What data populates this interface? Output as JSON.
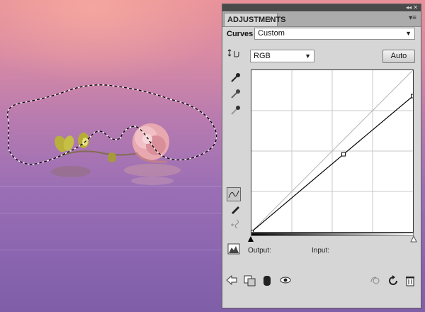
{
  "panel": {
    "tab_title": "ADJUSTMENTS",
    "tab_close": "×",
    "titlebar_buttons": "◂◂ ✕",
    "menu_icon": "▾≡",
    "adjustment_label": "Curves",
    "preset_value": "Custom",
    "channel_value": "RGB",
    "auto_label": "Auto",
    "output_label": "Output:",
    "input_label": "Input:"
  },
  "curve": {
    "points": [
      [
        0,
        0
      ],
      [
        57,
        48
      ],
      [
        100,
        84
      ]
    ]
  },
  "icons": {
    "left_tools": [
      "on-image-adjust-icon",
      "eyedropper-black-icon",
      "eyedropper-gray-icon",
      "eyedropper-white-icon"
    ],
    "mode_tools": [
      "curve-points-icon",
      "pencil-draw-icon",
      "smooth-curve-icon"
    ],
    "bottom": [
      "back-arrow-icon",
      "clip-to-layer-icon",
      "layer-mask-icon",
      "visibility-eye-icon",
      "view-previous-icon",
      "reset-icon",
      "delete-icon"
    ]
  },
  "colors": {
    "panel_bg": "#d6d6d6",
    "curve_line": "#000000",
    "diagonal_line": "#b5b5b5"
  }
}
